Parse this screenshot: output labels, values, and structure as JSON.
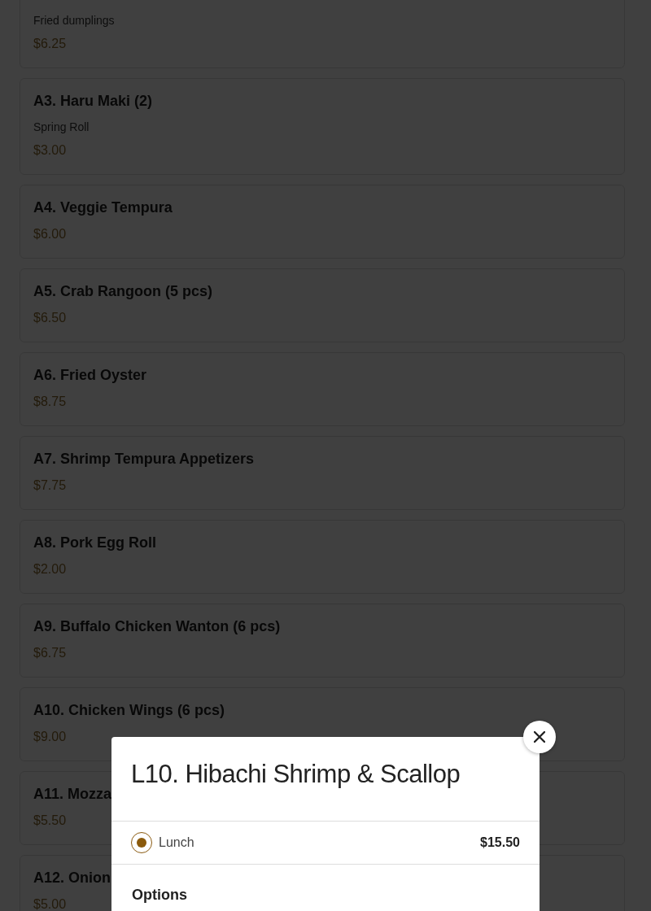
{
  "menu_items": [
    {
      "description": "Fried dumplings",
      "price": "$6.25"
    },
    {
      "name": "A3. Haru Maki (2)",
      "description": "Spring Roll",
      "price": "$3.00"
    },
    {
      "name": "A4. Veggie Tempura",
      "price": "$6.00"
    },
    {
      "name": "A5. Crab Rangoon (5 pcs)",
      "price": "$6.50"
    },
    {
      "name": "A6. Fried Oyster",
      "price": "$8.75"
    },
    {
      "name": "A7. Shrimp Tempura Appetizers",
      "price": "$7.75"
    },
    {
      "name": "A8. Pork Egg Roll",
      "price": "$2.00"
    },
    {
      "name": "A9. Buffalo Chicken Wanton (6 pcs)",
      "price": "$6.75"
    },
    {
      "name": "A10. Chicken Wings (6 pcs)",
      "price": "$9.00"
    },
    {
      "name": "A11. Mozza",
      "price": "$5.50"
    },
    {
      "name": "A12. Onion",
      "price": "$5.00"
    }
  ],
  "modal": {
    "title": "L10. Hibachi Shrimp & Scallop",
    "variants": [
      {
        "label": "Lunch",
        "price": "$15.50",
        "selected": true
      }
    ],
    "section_heading": "Options"
  }
}
